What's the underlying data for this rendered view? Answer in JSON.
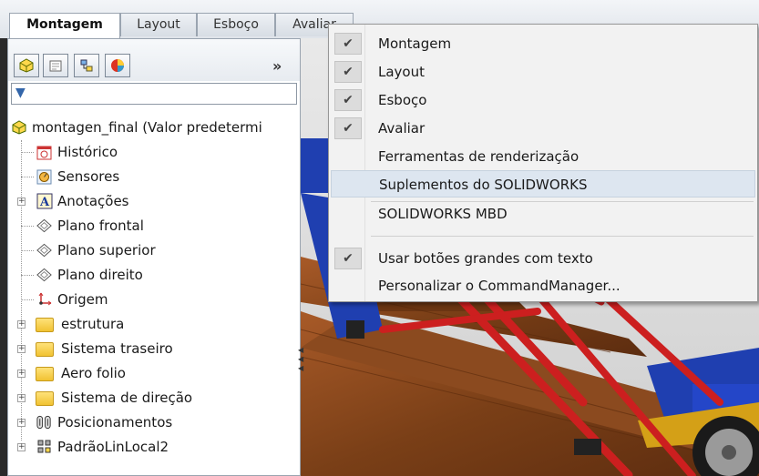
{
  "tabs": [
    {
      "label": "Montagem",
      "active": true
    },
    {
      "label": "Layout",
      "active": false
    },
    {
      "label": "Esboço",
      "active": false
    },
    {
      "label": "Avaliar",
      "active": false
    }
  ],
  "panel": {
    "toolbar_more": "»",
    "tree": [
      {
        "label": "montagen_final  (Valor predetermi",
        "icon": "assembly-icon",
        "expander": ""
      },
      {
        "label": "Histórico",
        "icon": "history-icon",
        "expander": ""
      },
      {
        "label": "Sensores",
        "icon": "sensor-icon",
        "expander": ""
      },
      {
        "label": "Anotações",
        "icon": "annotation-icon",
        "expander": "+"
      },
      {
        "label": "Plano frontal",
        "icon": "plane-icon",
        "expander": ""
      },
      {
        "label": "Plano superior",
        "icon": "plane-icon",
        "expander": ""
      },
      {
        "label": "Plano direito",
        "icon": "plane-icon",
        "expander": ""
      },
      {
        "label": "Origem",
        "icon": "origin-icon",
        "expander": ""
      },
      {
        "label": "estrutura",
        "icon": "folder-icon",
        "expander": "+"
      },
      {
        "label": "Sistema traseiro",
        "icon": "folder-icon",
        "expander": "+"
      },
      {
        "label": "Aero folio",
        "icon": "folder-icon",
        "expander": "+"
      },
      {
        "label": "Sistema de direção",
        "icon": "folder-icon",
        "expander": "+"
      },
      {
        "label": "Posicionamentos",
        "icon": "mates-icon",
        "expander": "+"
      },
      {
        "label": "PadrãoLinLocal2",
        "icon": "pattern-icon",
        "expander": "+"
      }
    ]
  },
  "menu": {
    "items": [
      {
        "label": "Montagem",
        "checked": true
      },
      {
        "label": "Layout",
        "checked": true
      },
      {
        "label": "Esboço",
        "checked": true
      },
      {
        "label": "Avaliar",
        "checked": true
      },
      {
        "label": "Ferramentas de renderização",
        "checked": false
      },
      {
        "label": "Suplementos do SOLIDWORKS",
        "checked": false,
        "hover": true
      },
      {
        "label": "SOLIDWORKS MBD",
        "checked": false
      },
      {
        "label": "Usar botões grandes com texto",
        "checked": true
      },
      {
        "label": "Personalizar o CommandManager...",
        "checked": false
      }
    ],
    "check_glyph": "✔"
  },
  "colors": {
    "frame_red": "#cc1f1f",
    "frame_blue": "#1f3fb0",
    "wood": "#8a4a1e",
    "menu_hover": "#dde6f0"
  }
}
